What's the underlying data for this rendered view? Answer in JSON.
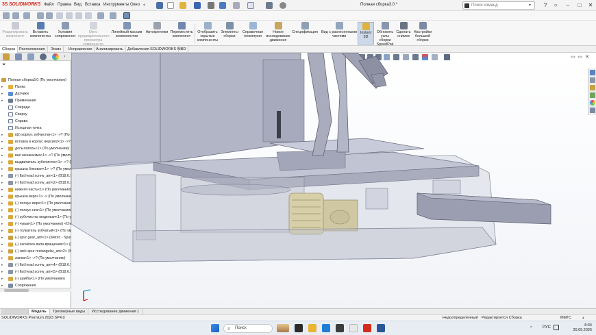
{
  "title_bar": {
    "logo_prefix": "3S",
    "logo_name": "SOLIDWORKS",
    "menus": [
      "Файл",
      "Правка",
      "Вид",
      "Вставка",
      "Инструменты",
      "Окно"
    ],
    "document_title": "Полная сборка3.0 *",
    "search_placeholder": "Поиск команд"
  },
  "ribbon": {
    "buttons": [
      {
        "label": "Редактировать компонент",
        "enabled": false
      },
      {
        "label": "Вставить компоненты",
        "enabled": true
      },
      {
        "label": "Условия сопряжения",
        "enabled": true
      },
      {
        "label": "Окно предварительного просмотра компонента",
        "enabled": false
      },
      {
        "label": "Линейный массив компонентов",
        "enabled": true
      },
      {
        "label": "Автокрепежи",
        "enabled": true
      },
      {
        "label": "Переместить компонент",
        "enabled": true
      },
      {
        "label": "Отобразить скрытые компоненты",
        "enabled": true
      },
      {
        "label": "Элементы сборки",
        "enabled": true
      },
      {
        "label": "Справочная геометрия",
        "enabled": true
      },
      {
        "label": "Новое исследование движения",
        "enabled": true
      },
      {
        "label": "Спецификация",
        "enabled": true
      },
      {
        "label": "Вид с разнесенными частями",
        "enabled": true
      },
      {
        "label": "Instant 3D",
        "enabled": true
      },
      {
        "label": "Обновить узлы сборки SpeedPak",
        "enabled": true
      },
      {
        "label": "Сделать снимок",
        "enabled": true
      },
      {
        "label": "Настройки большой сборки",
        "enabled": true
      }
    ]
  },
  "command_tabs": [
    "Сборка",
    "Расположение",
    "Эскиз",
    "Исправление",
    "Анализировать",
    "Добавления SOLIDWORKS",
    "MBD"
  ],
  "feature_tree": {
    "root": "Полная сборка3.0 (По умолчанию)",
    "items": [
      {
        "label": "Папка",
        "kind": "folder"
      },
      {
        "label": "Датчики",
        "kind": "sensor"
      },
      {
        "label": "Примечания",
        "kind": "annotation"
      },
      {
        "label": "Спереди",
        "kind": "plane"
      },
      {
        "label": "Сверху",
        "kind": "plane"
      },
      {
        "label": "Справа",
        "kind": "plane"
      },
      {
        "label": "Исходная точка",
        "kind": "origin"
      },
      {
        "label": "(ф) корпус зубчистки<1> ->? (По умолчанию)",
        "kind": "part"
      },
      {
        "label": "вставка в корпус версия2<1> ->? (По умолчанию)",
        "kind": "part"
      },
      {
        "label": "досылатель<1> (По умолчанию)",
        "kind": "part"
      },
      {
        "label": "вал механизма<1> ->? (По умолчанию)",
        "kind": "part"
      },
      {
        "label": "выдвигатель зубочисток<1> ->? (По умолчанию)",
        "kind": "part"
      },
      {
        "label": "крышка боковая<1> ->? (По умолчанию)",
        "kind": "part"
      },
      {
        "label": "(-) flat head screw_am<1> (B18.6.7M)",
        "kind": "screw"
      },
      {
        "label": "(-) flat head screw_am<2> (B18.6.7M)",
        "kind": "screw"
      },
      {
        "label": "нижняя часть<1> (По умолчанию)",
        "kind": "part"
      },
      {
        "label": "крышка верх<1> -> (По умолчанию)",
        "kind": "part"
      },
      {
        "label": "(-) ползун верх<1> (По умолчанию)",
        "kind": "part"
      },
      {
        "label": "(-) ползун низ<1> (По умолчанию)",
        "kind": "part"
      },
      {
        "label": "(-) зубочистка модельки<1> (По умолчанию)",
        "kind": "part"
      },
      {
        "label": "(-) чувак<1> (По умолчанию) <Отображение>",
        "kind": "part"
      },
      {
        "label": "(-) толкатель зубчатый<1> (По умолчанию)",
        "kind": "part"
      },
      {
        "label": "(-) spur gear_am<1> (Metric - Spur gear)",
        "kind": "gear"
      },
      {
        "label": "(-) засчёлка вала вращения<1> (По умолчанию)",
        "kind": "part"
      },
      {
        "label": "(-) rack spur rectangular_am<2> (Metric)",
        "kind": "gear"
      },
      {
        "label": "лапка<1> ->? (По умолчанию)",
        "kind": "part"
      },
      {
        "label": "(-) flat head screw_am<4> (B18.6.7M)",
        "kind": "screw"
      },
      {
        "label": "(-) flat head screw_am<5> (B18.6.7M)",
        "kind": "screw"
      },
      {
        "label": "(-) шайба<1> (По умолчанию)",
        "kind": "part"
      },
      {
        "label": "Сопряжения",
        "kind": "mates"
      }
    ]
  },
  "bottom_tabs": [
    "Модель",
    "Трехмерные виды",
    "Исследование движения 1"
  ],
  "status_bar": {
    "left": "SOLIDWORKS Premium 2023 SP4.0",
    "state": "Недоопределенный",
    "mode": "Редактируется Сборка",
    "units": "ММГС"
  },
  "taskbar": {
    "search_label": "Поиск",
    "lang": "РУС",
    "time": "8:34",
    "date": "20.09.2026"
  },
  "colors": {
    "brand_red": "#d52b1e",
    "part_fill": "#b9bccc",
    "part_dark": "#8e92a6",
    "gear": "#d6cfa8",
    "accent": "#1e90d8"
  }
}
